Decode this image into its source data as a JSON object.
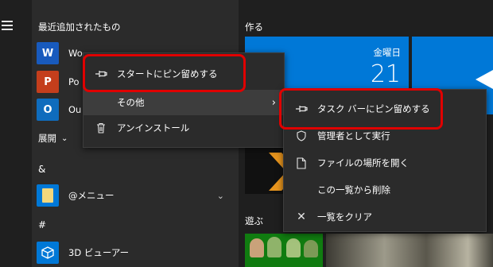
{
  "start_menu": {
    "recent_heading": "最近追加されたもの",
    "apps": [
      {
        "label": "Wo",
        "icon": "word-icon",
        "icon_text": "W",
        "color": "#185abd"
      },
      {
        "label": "Po",
        "icon": "powerpoint-icon",
        "icon_text": "P",
        "color": "#c43e1c"
      },
      {
        "label": "Ou",
        "icon": "outlook-icon",
        "icon_text": "O",
        "color": "#0f6cbd"
      }
    ],
    "expand_label": "展開",
    "letter_amp": "&",
    "folder_app": "@メニュー",
    "letter_hash": "#",
    "viewer_app": "3D ビューアー"
  },
  "tiles": {
    "create_heading": "作る",
    "calendar_day": "金曜日",
    "calendar_date": "21",
    "play_heading": "遊ぶ"
  },
  "context_menu": {
    "pin_start": "スタートにピン留めする",
    "more": "その他",
    "uninstall": "アンインストール"
  },
  "submenu": {
    "pin_taskbar": "タスク バーにピン留めする",
    "run_as_admin": "管理者として実行",
    "open_location": "ファイルの場所を開く",
    "remove_from_list": "この一覧から削除",
    "clear_list": "一覧をクリア"
  },
  "colors": {
    "highlight_border": "#e00000",
    "tile_blue": "#0078d7",
    "menu_bg": "#2b2b2b"
  }
}
